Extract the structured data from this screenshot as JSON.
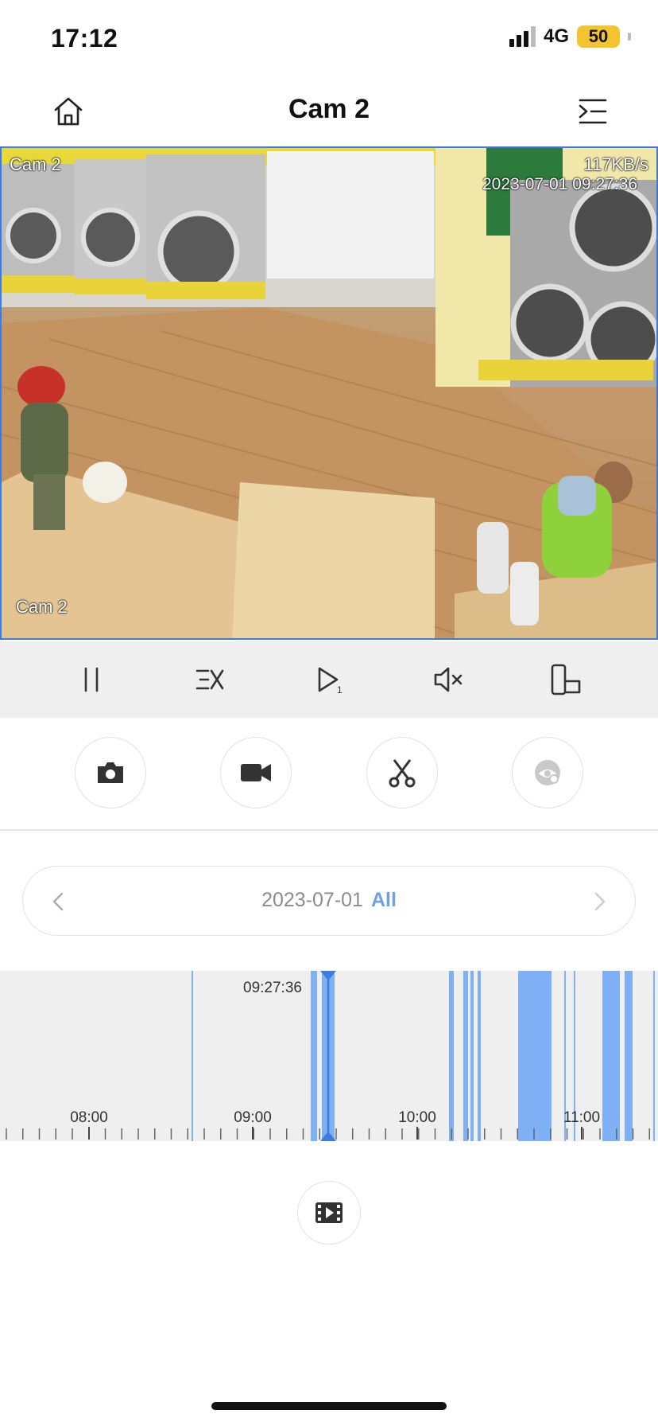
{
  "status_bar": {
    "time": "17:12",
    "network": "4G",
    "battery": "50",
    "battery_color": "#f4c430"
  },
  "header": {
    "title": "Cam 2",
    "left_icon": "home-icon",
    "right_icon": "menu-list-icon"
  },
  "video": {
    "osd_name_top": "Cam 2",
    "osd_speed": "117KB/s",
    "osd_timestamp": "2023-07-01 09:27:36",
    "osd_name_bottom": "Cam 2",
    "border_color": "#3c7be0"
  },
  "playback_controls": [
    {
      "name": "pause",
      "icon": "pause-icon"
    },
    {
      "name": "speed",
      "icon": "speed-multiplier-icon"
    },
    {
      "name": "step-play",
      "icon": "play-step-icon"
    },
    {
      "name": "mute",
      "icon": "speaker-muted-icon"
    },
    {
      "name": "rotate",
      "icon": "phone-rotate-icon"
    }
  ],
  "actions": [
    {
      "name": "snapshot",
      "icon": "camera-icon",
      "enabled": true
    },
    {
      "name": "record",
      "icon": "video-camera-icon",
      "enabled": true
    },
    {
      "name": "clip",
      "icon": "scissors-icon",
      "enabled": true
    },
    {
      "name": "privacy",
      "icon": "eye-shield-icon",
      "enabled": false
    }
  ],
  "date_selector": {
    "date": "2023-07-01",
    "filter": "All",
    "accent": "#6f9fe6"
  },
  "timeline": {
    "current_time": "09:27:36",
    "tick_labels": [
      "08:00",
      "09:00",
      "10:00",
      "11:00"
    ],
    "segment_color": "#7fb0f5",
    "playhead_color": "#3c7be0"
  },
  "bottom": {
    "icon": "film-clip-icon"
  }
}
